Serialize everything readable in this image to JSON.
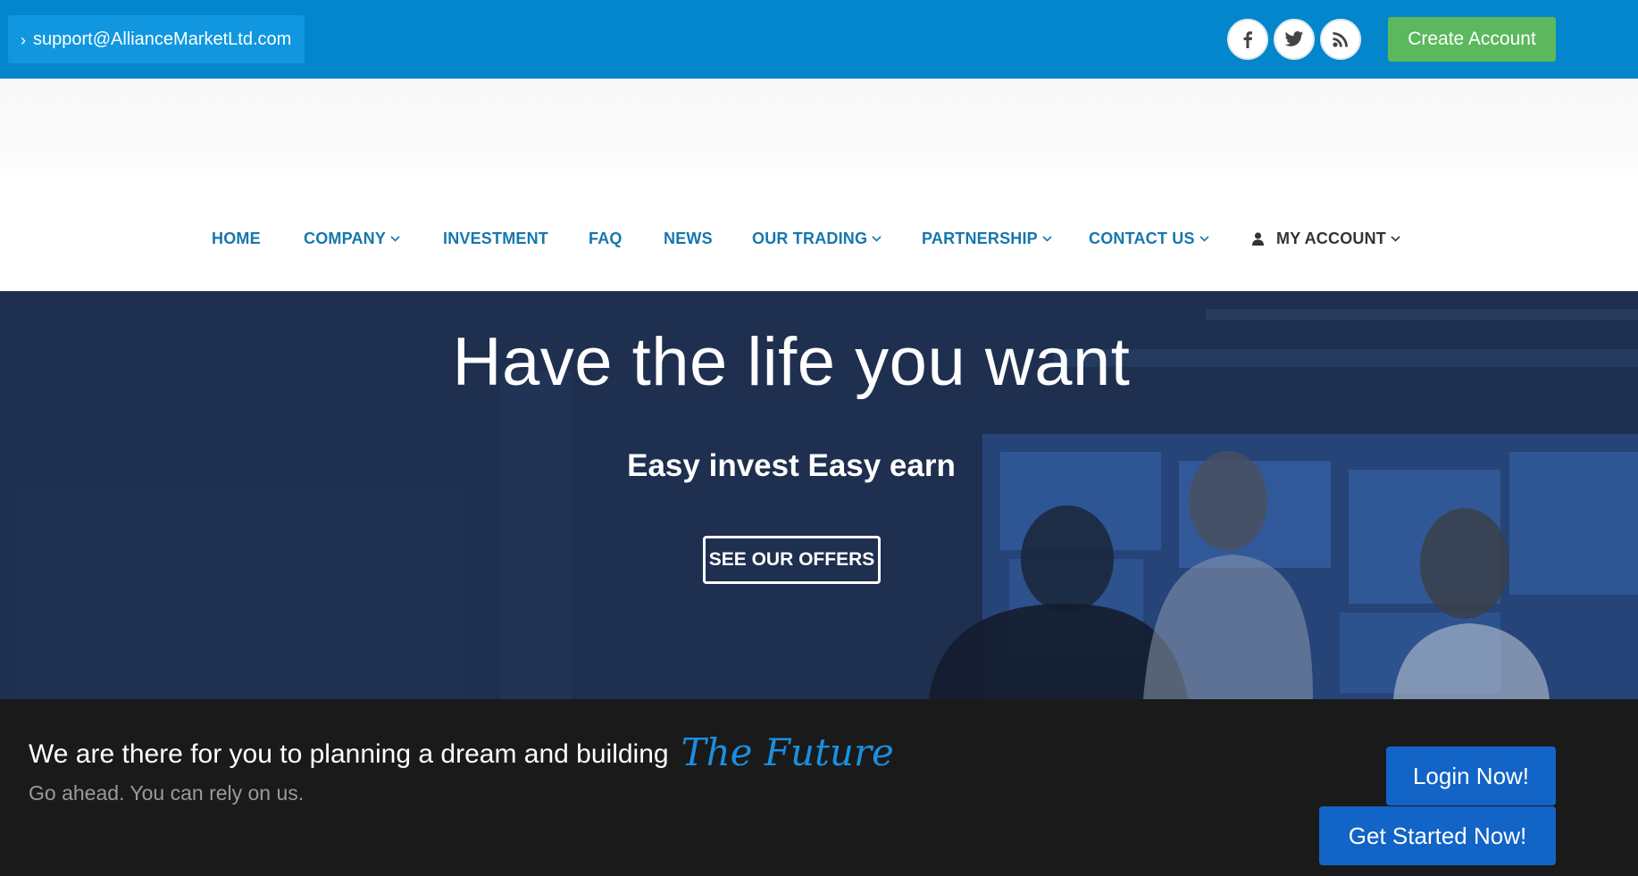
{
  "topbar": {
    "support_email": "support@AllianceMarketLtd.com",
    "social": [
      {
        "icon": "facebook-icon"
      },
      {
        "icon": "twitter-icon"
      },
      {
        "icon": "rss-icon"
      }
    ],
    "create_account_label": "Create Account"
  },
  "nav": {
    "items": [
      {
        "label": "HOME",
        "dropdown": false
      },
      {
        "label": "COMPANY",
        "dropdown": true
      },
      {
        "label": "INVESTMENT",
        "dropdown": false
      },
      {
        "label": "FAQ",
        "dropdown": false
      },
      {
        "label": "NEWS",
        "dropdown": false
      },
      {
        "label": "OUR TRADING",
        "dropdown": true
      },
      {
        "label": "PARTNERSHIP",
        "dropdown": true
      },
      {
        "label": "CONTACT US",
        "dropdown": true
      },
      {
        "label": "MY ACCOUNT",
        "dropdown": true,
        "icon": "user-icon"
      }
    ]
  },
  "hero": {
    "title": "Have the life you want",
    "subtitle": "Easy invest Easy earn",
    "cta_label": "SEE OUR OFFERS"
  },
  "footer_band": {
    "tagline": "We are there for you to planning a dream and building",
    "tagline_accent": "The Future",
    "subline": "Go ahead. You can rely on us.",
    "login_label": "Login Now!",
    "get_started_label": "Get Started Now!"
  },
  "colors": {
    "topbar": "#0386cc",
    "nav_link": "#1677ad",
    "create_account": "#5cb85c",
    "cta_blue": "#1264c6",
    "accent": "#1a8fe0",
    "dark_band": "#1a1a1a"
  }
}
